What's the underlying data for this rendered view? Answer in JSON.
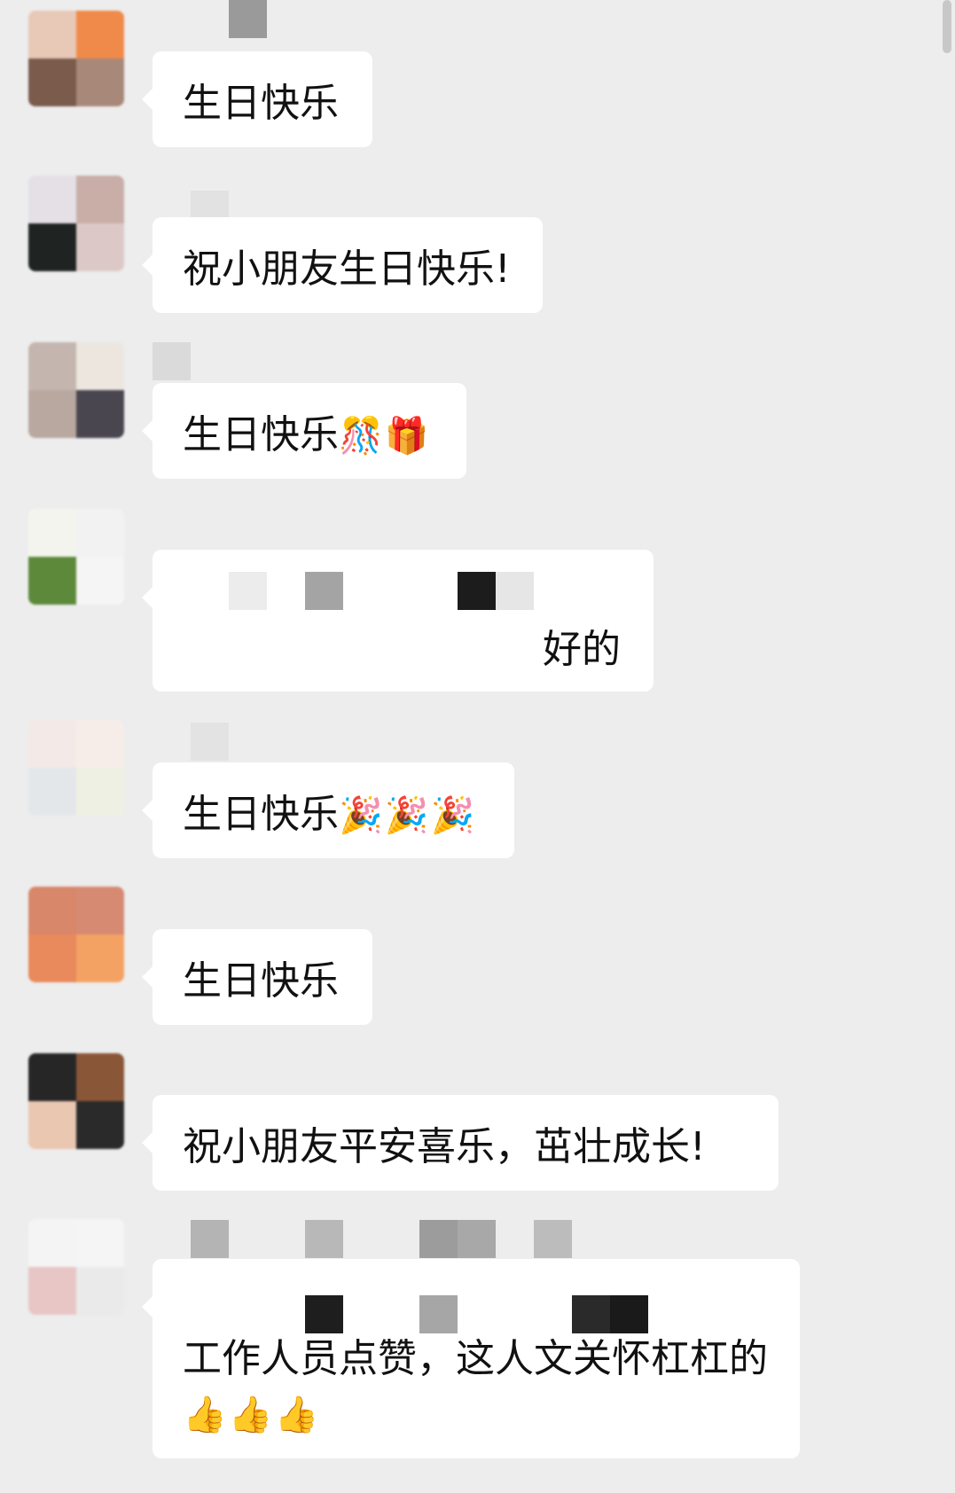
{
  "messages": [
    {
      "text": "生日快乐",
      "emoji": ""
    },
    {
      "text": "祝小朋友生日快乐!",
      "emoji": ""
    },
    {
      "text": "生日快乐",
      "emoji": "🎊🎁"
    },
    {
      "text": "好的",
      "emoji": ""
    },
    {
      "text": "生日快乐",
      "emoji": "🎉🎉🎉"
    },
    {
      "text": "生日快乐",
      "emoji": ""
    },
    {
      "text": "祝小朋友平安喜乐，茁壮成长!",
      "emoji": ""
    },
    {
      "text": "工作人员点赞，这人文关怀杠杠的",
      "emoji": "👍👍👍"
    }
  ],
  "colors": {
    "background": "#ededed",
    "bubble": "#ffffff",
    "text": "#111111"
  }
}
